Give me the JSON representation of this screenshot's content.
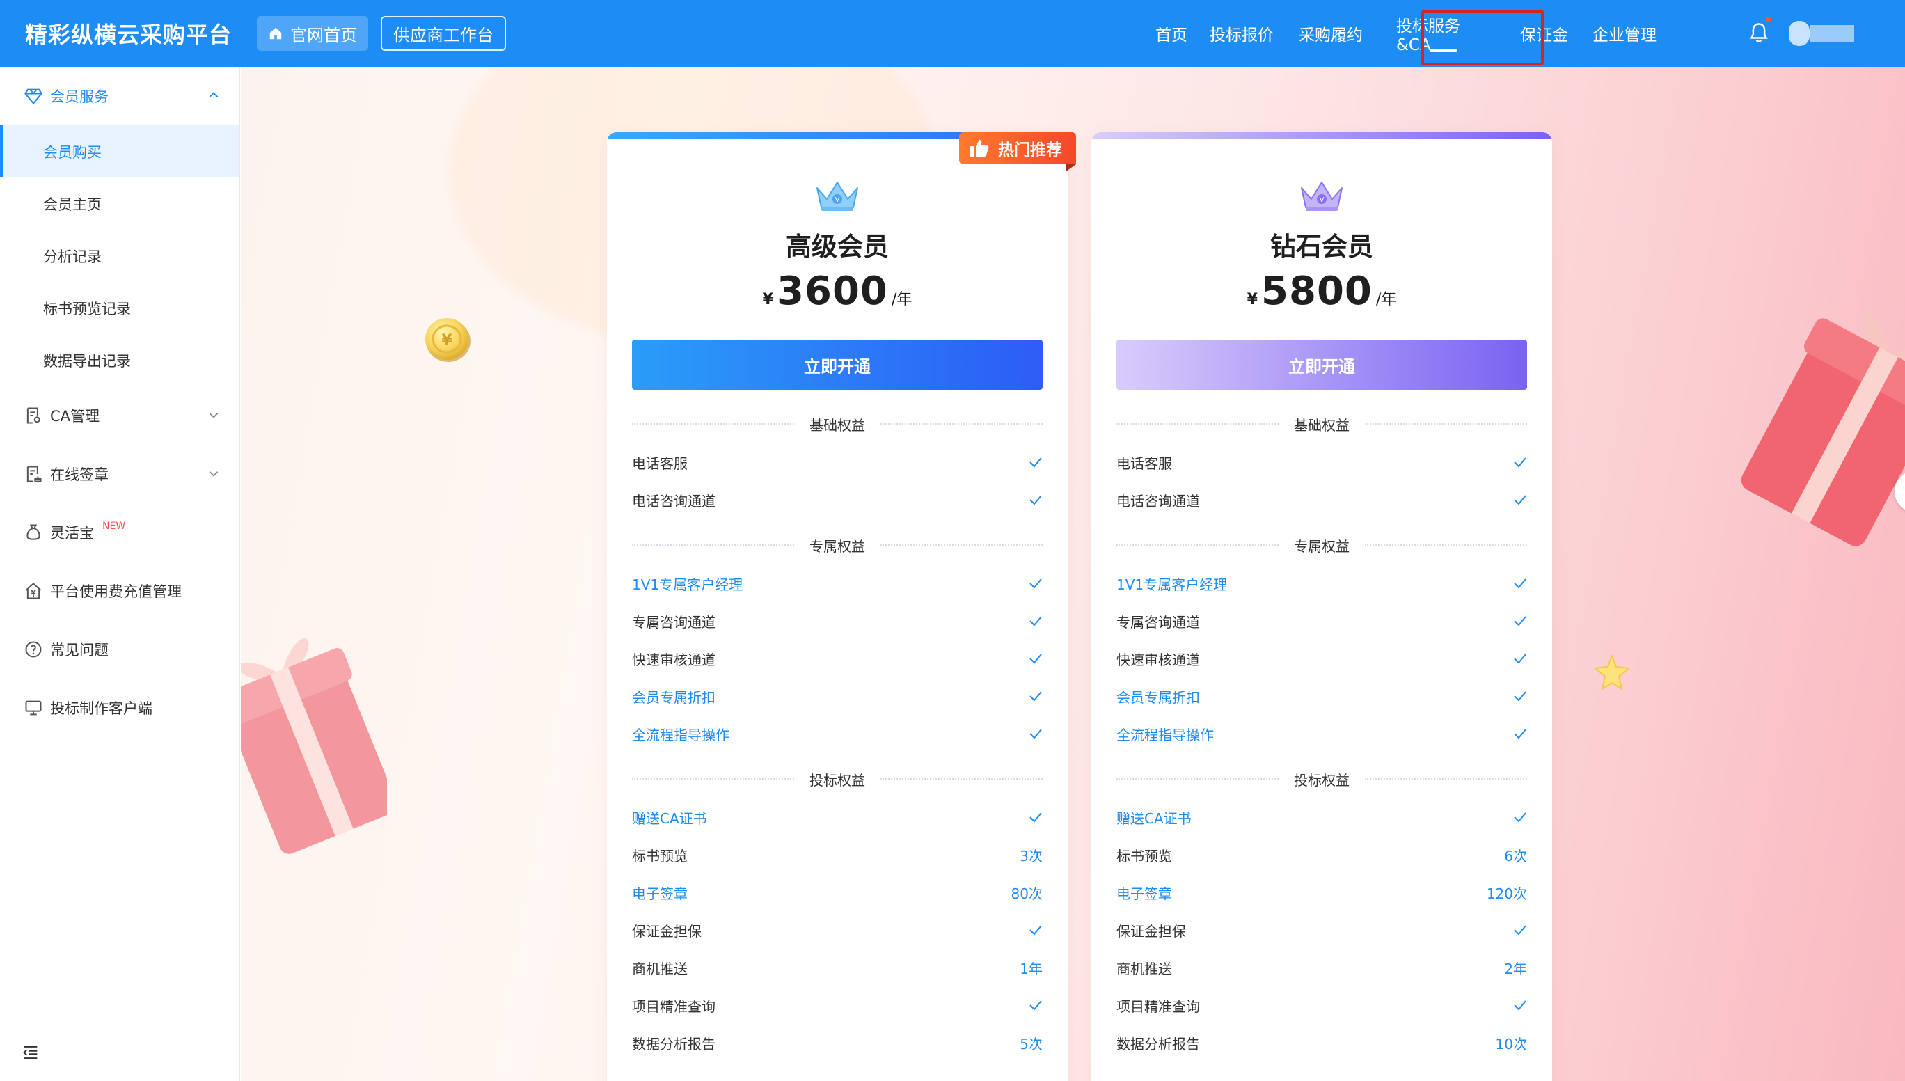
{
  "header": {
    "logo": "精彩纵横云采购平台",
    "home_btn": "官网首页",
    "workbench_btn": "供应商工作台",
    "nav": [
      "首页",
      "投标报价",
      "采购履约",
      "投标服务&CA",
      "保证金",
      "企业管理"
    ],
    "active_nav": "投标服务&CA"
  },
  "sidebar": {
    "member_service": "会员服务",
    "member_items": [
      "会员购买",
      "会员主页",
      "分析记录",
      "标书预览记录",
      "数据导出记录"
    ],
    "ca": "CA管理",
    "sign": "在线签章",
    "lingvao": "灵活宝",
    "new_badge": "NEW",
    "fee": "平台使用费充值管理",
    "faq": "常见问题",
    "client": "投标制作客户端"
  },
  "hot_tag": "热门推荐",
  "plans": [
    {
      "title": "高级会员",
      "currency": "¥",
      "price": "3600",
      "unit": "/年",
      "button": "立即开通",
      "basic_title": "基础权益",
      "basic": [
        "电话客服",
        "电话咨询通道"
      ],
      "exclusive_title": "专属权益",
      "exclusive": [
        "1V1专属客户经理",
        "专属咨询通道",
        "快速审核通道",
        "会员专属折扣",
        "全流程指导操作"
      ],
      "bid_title": "投标权益",
      "bid": [
        {
          "name": "赠送CA证书",
          "value": ""
        },
        {
          "name": "标书预览",
          "value": "3次"
        },
        {
          "name": "电子签章",
          "value": "80次"
        },
        {
          "name": "保证金担保",
          "value": ""
        },
        {
          "name": "商机推送",
          "value": "1年"
        },
        {
          "name": "项目精准查询",
          "value": ""
        },
        {
          "name": "数据分析报告",
          "value": "5次"
        }
      ]
    },
    {
      "title": "钻石会员",
      "currency": "¥",
      "price": "5800",
      "unit": "/年",
      "button": "立即开通",
      "basic_title": "基础权益",
      "basic": [
        "电话客服",
        "电话咨询通道"
      ],
      "exclusive_title": "专属权益",
      "exclusive": [
        "1V1专属客户经理",
        "专属咨询通道",
        "快速审核通道",
        "会员专属折扣",
        "全流程指导操作"
      ],
      "bid_title": "投标权益",
      "bid": [
        {
          "name": "赠送CA证书",
          "value": ""
        },
        {
          "name": "标书预览",
          "value": "6次"
        },
        {
          "name": "电子签章",
          "value": "120次"
        },
        {
          "name": "保证金担保",
          "value": ""
        },
        {
          "name": "商机推送",
          "value": "2年"
        },
        {
          "name": "项目精准查询",
          "value": ""
        },
        {
          "name": "数据分析报告",
          "value": "10次"
        }
      ]
    }
  ],
  "colors": {
    "primary": "#1e8cf5",
    "advanced_btn_from": "#2a9df8",
    "advanced_btn_to": "#2d5cf6",
    "diamond_btn_from": "#d9ccfb",
    "diamond_btn_to": "#7a62f2",
    "hot_tag": "#f5472b"
  }
}
